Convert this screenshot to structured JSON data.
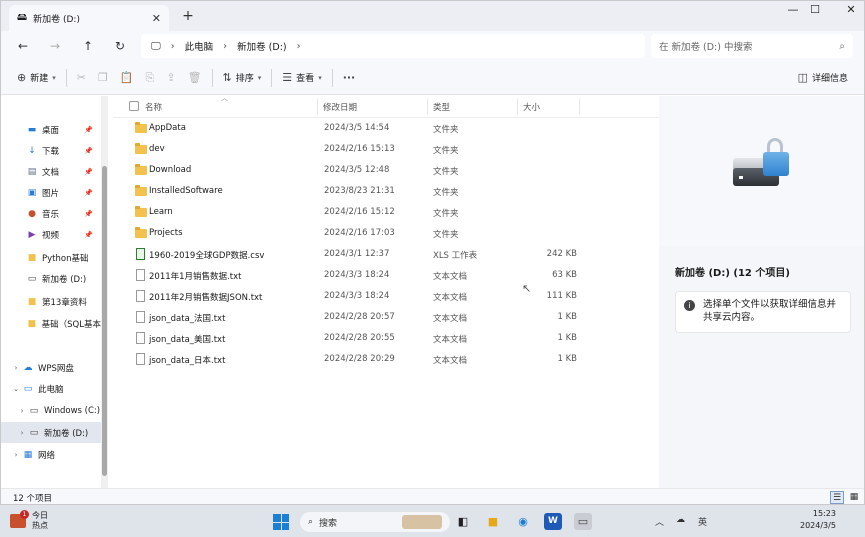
{
  "tab": {
    "title": "新加卷 (D:)"
  },
  "address": {
    "segments": [
      "此电脑",
      "新加卷 (D:)"
    ]
  },
  "search": {
    "placeholder": "在 新加卷 (D:) 中搜索"
  },
  "commands": {
    "new_label": "新建",
    "sort_label": "排序",
    "view_label": "查看",
    "details_label": "详细信息"
  },
  "sidebar": {
    "items": [
      {
        "label": "桌面",
        "icon": "desktop-icon",
        "pinned": true
      },
      {
        "label": "下载",
        "icon": "download-icon",
        "pinned": true
      },
      {
        "label": "文档",
        "icon": "document-icon",
        "pinned": true
      },
      {
        "label": "图片",
        "icon": "picture-icon",
        "pinned": true
      },
      {
        "label": "音乐",
        "icon": "music-icon",
        "pinned": true
      },
      {
        "label": "视频",
        "icon": "video-icon",
        "pinned": true
      },
      {
        "label": "Python基础",
        "icon": "folder-icon"
      },
      {
        "label": "新加卷 (D:)",
        "icon": "drive-icon"
      },
      {
        "label": "第13章资料",
        "icon": "folder-icon"
      },
      {
        "label": "基础（SQL基本",
        "icon": "folder-icon"
      },
      {
        "label": "WPS网盘",
        "icon": "cloud-icon"
      },
      {
        "label": "此电脑",
        "icon": "computer-icon"
      },
      {
        "label": "Windows (C:)",
        "icon": "drive-icon"
      },
      {
        "label": "新加卷 (D:)",
        "icon": "drive-icon"
      },
      {
        "label": "网络",
        "icon": "network-icon"
      }
    ]
  },
  "columns": {
    "name": "名称",
    "modified": "修改日期",
    "type": "类型",
    "size": "大小"
  },
  "files": [
    {
      "name": "AppData",
      "modified": "2024/3/5 14:54",
      "type": "文件夹",
      "size": "",
      "kind": "folder"
    },
    {
      "name": "dev",
      "modified": "2024/2/16 15:13",
      "type": "文件夹",
      "size": "",
      "kind": "folder"
    },
    {
      "name": "Download",
      "modified": "2024/3/5 12:48",
      "type": "文件夹",
      "size": "",
      "kind": "folder"
    },
    {
      "name": "InstalledSoftware",
      "modified": "2023/8/23 21:31",
      "type": "文件夹",
      "size": "",
      "kind": "folder"
    },
    {
      "name": "Learn",
      "modified": "2024/2/16 15:12",
      "type": "文件夹",
      "size": "",
      "kind": "folder"
    },
    {
      "name": "Projects",
      "modified": "2024/2/16 17:03",
      "type": "文件夹",
      "size": "",
      "kind": "folder"
    },
    {
      "name": "1960-2019全球GDP数据.csv",
      "modified": "2024/3/1 12:37",
      "type": "XLS 工作表",
      "size": "242 KB",
      "kind": "csv"
    },
    {
      "name": "2011年1月销售数据.txt",
      "modified": "2024/3/3 18:24",
      "type": "文本文档",
      "size": "63 KB",
      "kind": "txt"
    },
    {
      "name": "2011年2月销售数据JSON.txt",
      "modified": "2024/3/3 18:24",
      "type": "文本文档",
      "size": "111 KB",
      "kind": "txt"
    },
    {
      "name": "json_data_法国.txt",
      "modified": "2024/2/28 20:57",
      "type": "文本文档",
      "size": "1 KB",
      "kind": "txt"
    },
    {
      "name": "json_data_美国.txt",
      "modified": "2024/2/28 20:55",
      "type": "文本文档",
      "size": "1 KB",
      "kind": "txt"
    },
    {
      "name": "json_data_日本.txt",
      "modified": "2024/2/28 20:29",
      "type": "文本文档",
      "size": "1 KB",
      "kind": "txt"
    }
  ],
  "details": {
    "title": "新加卷 (D:) (12 个项目)",
    "info": "选择单个文件以获取详细信息并共享云内容。"
  },
  "status": {
    "count": "12 个项目"
  },
  "taskbar": {
    "weather_line1": "今日",
    "weather_line2": "热点",
    "weather_badge": "1",
    "search_label": "搜索",
    "ime": "英",
    "clock_time": "15:23",
    "clock_date": "2024/3/5"
  }
}
